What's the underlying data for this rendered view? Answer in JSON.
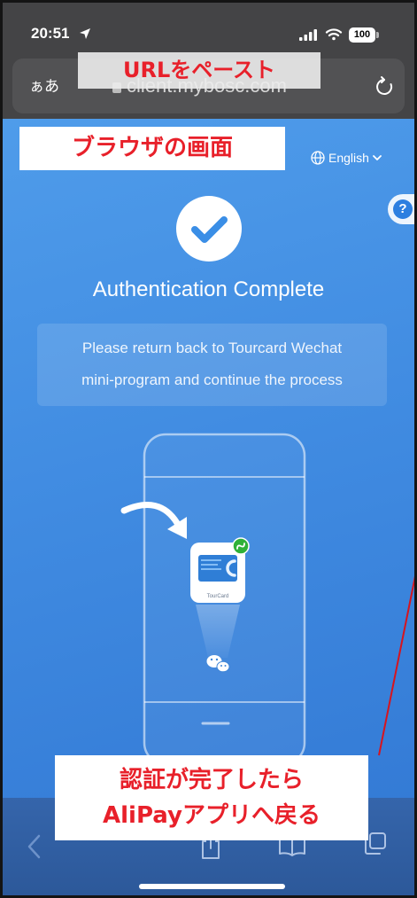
{
  "status_bar": {
    "time": "20:51",
    "battery_level": "100",
    "icons": [
      "location-arrow-icon",
      "signal-icon",
      "wifi-icon",
      "battery-icon"
    ]
  },
  "address_bar": {
    "text_size_button": "ぁあ",
    "url": "client.mybosc.com",
    "icons": [
      "lock-icon",
      "reload-icon"
    ]
  },
  "annotations": {
    "url_hint": "URLをペースト",
    "browser_hint": "ブラウザの画面",
    "return_hint": [
      "認証が完了したら",
      "AliPayアプリへ戻る"
    ]
  },
  "page": {
    "language_selector": {
      "label": "English",
      "icons": [
        "globe-icon",
        "chevron-down-icon"
      ]
    },
    "help_button": "?",
    "status_icon": "check-circle-icon",
    "title": "Authentication Complete",
    "message": [
      "Please return back to Tourcard Wechat",
      "mini-program and continue the process"
    ],
    "illustration": {
      "icons": [
        "phone-outline",
        "curved-arrow-icon",
        "tourcard-app-icon",
        "mini-program-badge-icon",
        "wechat-icon"
      ],
      "app_icon_label": "TourCard"
    }
  },
  "toolbar": {
    "items": [
      {
        "icon": "back-chevron-icon",
        "enabled": false
      },
      {
        "icon": "share-icon",
        "enabled": true
      },
      {
        "icon": "bookmarks-icon",
        "enabled": true
      },
      {
        "icon": "tabs-icon",
        "enabled": true
      }
    ]
  },
  "colors": {
    "browser_chrome": "#444446",
    "page_background": "#408be1",
    "check_accent": "#3a8ee6",
    "annotation_text": "#e8202a",
    "annotation_line": "#d7141e",
    "mini_program_badge": "#2fb138"
  }
}
